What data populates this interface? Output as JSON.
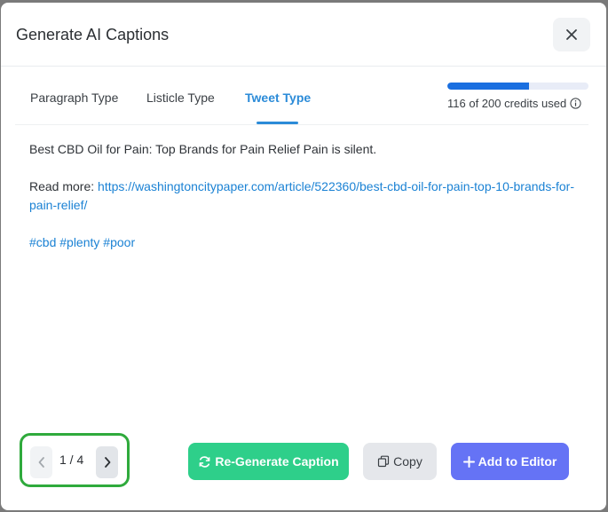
{
  "dialog": {
    "title": "Generate AI Captions"
  },
  "tabs": [
    {
      "label": "Paragraph Type"
    },
    {
      "label": "Listicle Type"
    },
    {
      "label": "Tweet Type"
    }
  ],
  "active_tab": "Tweet Type",
  "credits": {
    "text": "116 of 200 credits used",
    "used": 116,
    "total": 200,
    "fraction": 0.58
  },
  "caption": {
    "headline": "Best CBD Oil for Pain: Top Brands for Pain Relief Pain is silent.",
    "read_more_label": "Read more: ",
    "link": "https://washingtoncitypaper.com/article/522360/best-cbd-oil-for-pain-top-10-brands-for-pain-relief/",
    "hashtags": [
      "#cbd",
      "#plenty",
      "#poor"
    ]
  },
  "pager": {
    "text": "1 / 4"
  },
  "actions": {
    "regenerate_label": "Re-Generate Caption",
    "copy_label": "Copy",
    "add_label": "Add to Editor"
  },
  "icons": {
    "close": "close-icon",
    "info": "info-icon",
    "prev": "chevron-left-icon",
    "next": "chevron-right-icon",
    "refresh": "refresh-icon",
    "copy": "copy-icon",
    "plus": "plus-icon"
  },
  "colors": {
    "accent_blue": "#2b8bd8",
    "progress_fill": "#1a6fe0",
    "regenerate_green": "#2ecf8a",
    "add_purple": "#6573f5",
    "highlight_green": "#2faa3c"
  }
}
